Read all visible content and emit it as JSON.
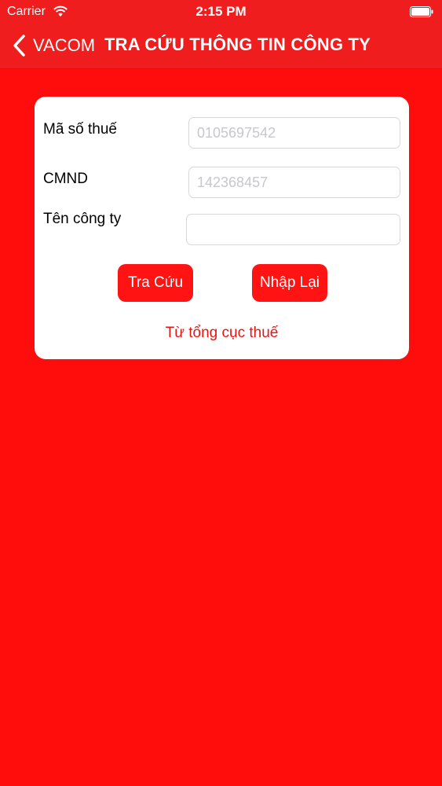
{
  "status_bar": {
    "carrier": "Carrier",
    "time": "2:15 PM",
    "icons": [
      "wifi-icon",
      "battery-icon"
    ]
  },
  "nav": {
    "back_label": "VACOM",
    "title": "TRA CỨU THÔNG TIN CÔNG TY",
    "back_icon": "chevron-left-icon"
  },
  "form": {
    "tax_code": {
      "label": "Mã số thuế",
      "placeholder": "0105697542",
      "value": ""
    },
    "id_number": {
      "label": "CMND",
      "placeholder": "142368457",
      "value": ""
    },
    "company_name": {
      "label": "Tên công ty",
      "placeholder": "",
      "value": ""
    },
    "search_button": "Tra Cứu",
    "reset_button": "Nhập Lại",
    "source_link": "Từ tổng cục thuế"
  },
  "colors": {
    "background": "#ff0d0d",
    "bar": "#ef1d1d",
    "button": "#ff1313",
    "link": "#e81414"
  }
}
